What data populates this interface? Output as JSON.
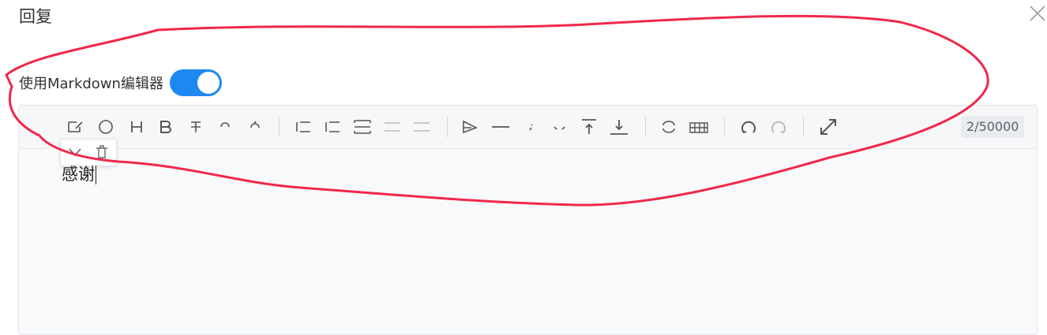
{
  "dialog": {
    "title": "回复"
  },
  "markdown_toggle": {
    "label": "使用Markdown编辑器",
    "on": true
  },
  "toolbar": {
    "groups": [
      [
        "edit-icon",
        "emoji-icon",
        "heading-icon",
        "bold-icon",
        "strikethrough-icon",
        "italic-icon",
        "link-icon"
      ],
      [
        "unordered-list-icon",
        "ordered-list-icon",
        "code-block-icon",
        "quote-icon",
        "horizontal-rule-icon"
      ],
      [
        "send-icon",
        "divider-line-icon",
        "dotted-icon",
        "more-icon",
        "upload-icon",
        "download-icon"
      ],
      [
        "link-chain-icon",
        "table-icon"
      ],
      [
        "undo-icon",
        "redo-icon"
      ],
      [
        "fullscreen-icon"
      ]
    ],
    "char_counter": "2/50000"
  },
  "block_popover": {
    "icons": [
      "chevron-down-icon",
      "trash-icon"
    ]
  },
  "editor": {
    "content": "感谢"
  },
  "colors": {
    "accent": "#1e88f0",
    "annotation": "#f0284a"
  }
}
